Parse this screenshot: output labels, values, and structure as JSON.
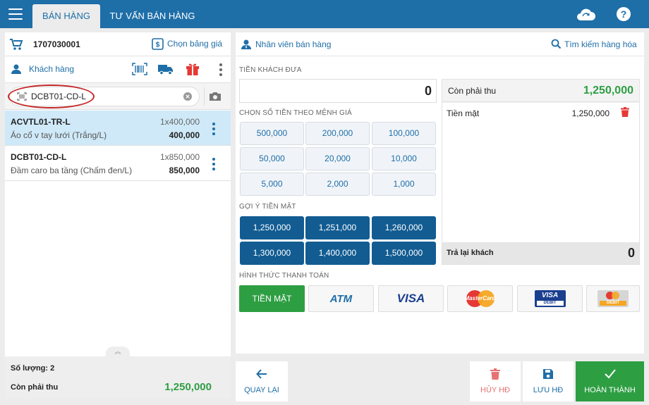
{
  "header": {
    "tabs": [
      {
        "label": "BÁN HÀNG"
      },
      {
        "label": "TƯ VẤN BÁN HÀNG"
      }
    ]
  },
  "left": {
    "order_id": "1707030001",
    "price_list_label": "Chọn bảng giá",
    "customer_label": "Khách hàng",
    "scan_value": "DCBT01-CD-L",
    "items": [
      {
        "code": "ACVTL01-TR-L",
        "name": "Áo cổ v tay lưới (Trắng/L)",
        "qty": "1x400,000",
        "total": "400,000"
      },
      {
        "code": "DCBT01-CD-L",
        "name": "Đầm caro ba tầng (Chấm đen/L)",
        "qty": "1x850,000",
        "total": "850,000"
      }
    ],
    "quantity_label": "Số lượng: 2",
    "due_label": "Còn phải thu",
    "due_value": "1,250,000"
  },
  "right": {
    "staff_label": "Nhân viên bán hàng",
    "search_label": "Tìm kiếm hàng hóa",
    "cash_given_label": "TIỀN KHÁCH ĐƯA",
    "cash_given_value": "0",
    "denom_label": "CHỌN SỐ TIỀN THEO MỆNH GIÁ",
    "denominations": [
      "500,000",
      "200,000",
      "100,000",
      "50,000",
      "20,000",
      "10,000",
      "5,000",
      "2,000",
      "1,000"
    ],
    "suggest_label": "GỢI Ý TIỀN MẶT",
    "suggestions": [
      "1,250,000",
      "1,251,000",
      "1,260,000",
      "1,300,000",
      "1,400,000",
      "1,500,000"
    ],
    "due_label": "Còn phải thu",
    "due_value": "1,250,000",
    "payment_line_label": "Tiền mặt",
    "payment_line_value": "1,250,000",
    "change_label": "Trả lại khách",
    "change_value": "0",
    "method_label": "HÌNH THỨC THANH TOÁN",
    "methods": {
      "cash": "TIỀN MẶT",
      "atm": "ATM",
      "visa": "VISA",
      "mastercard": "MasterCard",
      "visa_debit_top": "VISA",
      "visa_debit_bottom": "DEBIT",
      "mc_debit": "DEBIT"
    }
  },
  "footer": {
    "back": "QUAY LẠI",
    "cancel": "HỦY HĐ",
    "save": "LƯU HĐ",
    "complete": "HOÀN THÀNH"
  },
  "colors": {
    "primary": "#1e6ea8",
    "dark_button": "#125c92",
    "success": "#2e9e43",
    "danger": "#e53935"
  }
}
